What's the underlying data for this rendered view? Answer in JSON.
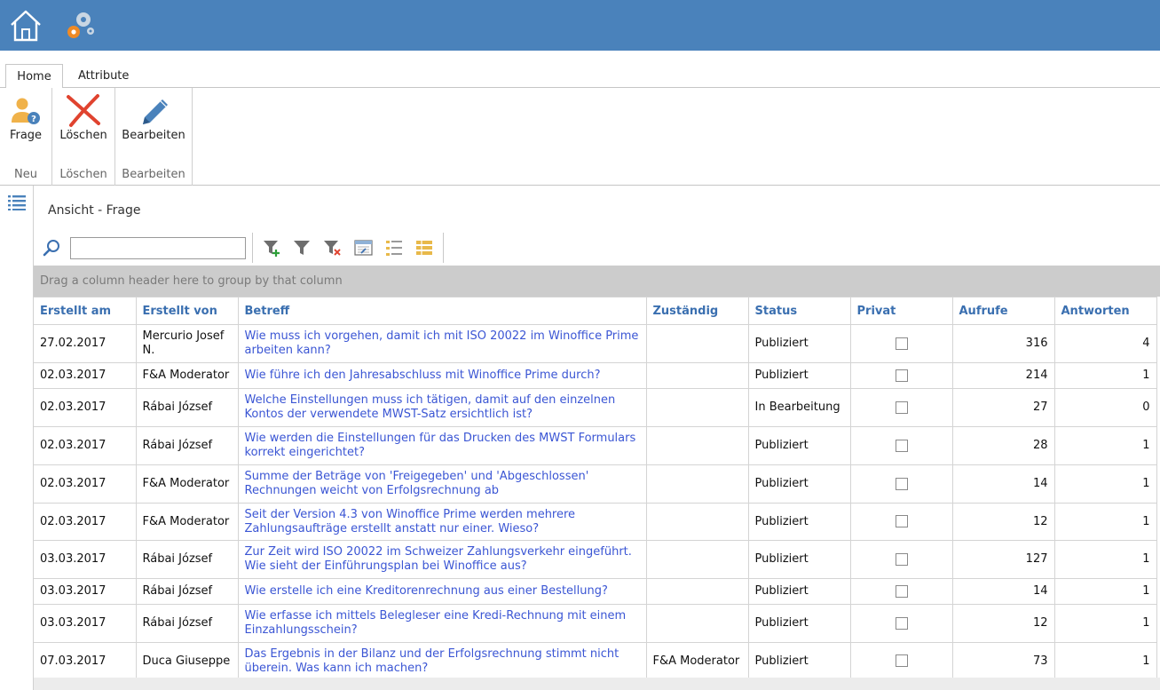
{
  "ribbon": {
    "tabs": [
      {
        "label": "Home"
      },
      {
        "label": "Attribute"
      }
    ],
    "groups": [
      {
        "button_label": "Frage",
        "group_label": "Neu"
      },
      {
        "button_label": "Löschen",
        "group_label": "Löschen"
      },
      {
        "button_label": "Bearbeiten",
        "group_label": "Bearbeiten"
      }
    ]
  },
  "view": {
    "title": "Ansicht - Frage",
    "search_value": "",
    "group_hint": "Drag a column header here to group by that column"
  },
  "colors": {
    "topbar": "#4a82bb",
    "header_text": "#3a6fb0",
    "link_text": "#3b56d4",
    "delete_red": "#e0432f"
  },
  "grid": {
    "columns": [
      "Erstellt am",
      "Erstellt von",
      "Betreff",
      "Zuständig",
      "Status",
      "Privat",
      "Aufrufe",
      "Antworten"
    ],
    "rows": [
      {
        "date": "27.02.2017",
        "author": "Mercurio Josef N.",
        "subject": "Wie muss ich vorgehen, damit ich mit ISO 20022 im Winoffice Prime arbeiten kann?",
        "assignee": "",
        "status": "Publiziert",
        "views": "316",
        "answers": "4"
      },
      {
        "date": "02.03.2017",
        "author": "F&A Moderator",
        "subject": "Wie führe ich den Jahresabschluss mit Winoffice Prime durch?",
        "assignee": "",
        "status": "Publiziert",
        "views": "214",
        "answers": "1"
      },
      {
        "date": "02.03.2017",
        "author": "Rábai József",
        "subject": "Welche Einstellungen muss ich tätigen, damit auf den einzelnen Kontos der verwendete MWST-Satz ersichtlich ist?",
        "assignee": "",
        "status": "In Bearbeitung",
        "views": "27",
        "answers": "0"
      },
      {
        "date": "02.03.2017",
        "author": "Rábai József",
        "subject": "Wie werden die Einstellungen für das Drucken des MWST Formulars korrekt eingerichtet?",
        "assignee": "",
        "status": "Publiziert",
        "views": "28",
        "answers": "1"
      },
      {
        "date": "02.03.2017",
        "author": "F&A Moderator",
        "subject": "Summe der Beträge von 'Freigegeben' und 'Abgeschlossen' Rechnungen weicht von Erfolgsrechnung ab",
        "assignee": "",
        "status": "Publiziert",
        "views": "14",
        "answers": "1"
      },
      {
        "date": "02.03.2017",
        "author": "F&A Moderator",
        "subject": "Seit der Version 4.3 von Winoffice Prime werden mehrere Zahlungsaufträge erstellt anstatt nur einer. Wieso?",
        "assignee": "",
        "status": "Publiziert",
        "views": "12",
        "answers": "1"
      },
      {
        "date": "03.03.2017",
        "author": "Rábai József",
        "subject": "Zur Zeit wird ISO 20022 im Schweizer Zahlungsverkehr eingeführt. Wie sieht der Einführungsplan bei Winoffice aus?",
        "assignee": "",
        "status": "Publiziert",
        "views": "127",
        "answers": "1"
      },
      {
        "date": "03.03.2017",
        "author": "Rábai József",
        "subject": "Wie erstelle ich eine Kreditorenrechnung aus einer Bestellung?",
        "assignee": "",
        "status": "Publiziert",
        "views": "14",
        "answers": "1"
      },
      {
        "date": "03.03.2017",
        "author": "Rábai József",
        "subject": "Wie erfasse ich mittels Belegleser eine Kredi-Rechnung mit einem Einzahlungsschein?",
        "assignee": "",
        "status": "Publiziert",
        "views": "12",
        "answers": "1"
      },
      {
        "date": "07.03.2017",
        "author": "Duca Giuseppe",
        "subject": "Das Ergebnis in der Bilanz und der Erfolgsrechnung stimmt nicht überein. Was kann ich machen?",
        "assignee": "F&A Moderator",
        "status": "Publiziert",
        "views": "73",
        "answers": "1"
      }
    ]
  }
}
